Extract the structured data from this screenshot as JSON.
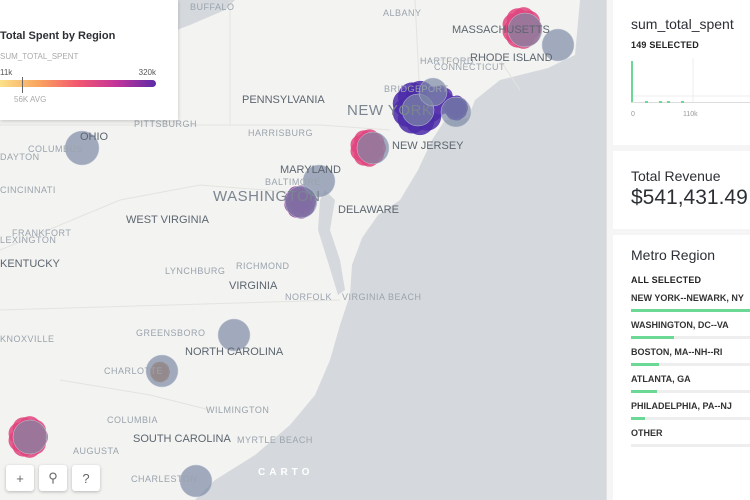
{
  "map": {
    "labels": [
      "BUFFALO",
      "ALBANY",
      "MASSACHUSETTS",
      "RHODE ISLAND",
      "HARTFORD",
      "CONNECTICUT",
      "BRIDGEPORT",
      "PENNSYLVANIA",
      "NEW YORK",
      "NEW JERSEY",
      "PITTSBURGH",
      "HARRISBURG",
      "OHIO",
      "COLUMBUS",
      "DAYTON",
      "MARYLAND",
      "BALTIMORE",
      "WASHINGTON",
      "DELAWARE",
      "CINCINNATI",
      "WEST VIRGINIA",
      "FRANKFORT",
      "LEXINGTON",
      "KENTUCKY",
      "LYNCHBURG",
      "RICHMOND",
      "VIRGINIA",
      "NORFOLK",
      "VIRGINIA BEACH",
      "KNOXVILLE",
      "GREENSBORO",
      "NORTH CAROLINA",
      "CHARLOTTE",
      "COLUMBIA",
      "WILMINGTON",
      "SOUTH CAROLINA",
      "MYRTLE BEACH",
      "AUGUSTA",
      "CHARLESTON"
    ],
    "colors": {
      "land": "#f3f3f1",
      "water": "#d5d9dd",
      "circle": "#7d8aa6"
    },
    "controls": {
      "zoom_in": "+",
      "search": "⚲",
      "help": "?"
    },
    "attribution": "CARTO"
  },
  "legend": {
    "title": "Total Spent by Region",
    "field": "SUM_TOTAL_SPENT",
    "min": "11k",
    "max": "320k",
    "avg": "56K AVG"
  },
  "sidebar": {
    "histogram": {
      "title": "sum_total_spent",
      "status": "149 SELECTED",
      "x_min": "0",
      "x_mid": "110k",
      "accent": "#6bd896"
    },
    "revenue": {
      "title": "Total Revenue",
      "value": "$541,431.49"
    },
    "metro": {
      "title": "Metro Region",
      "status": "ALL SELECTED",
      "items": [
        {
          "label": "NEW YORK--NEWARK, NY",
          "share": 100
        },
        {
          "label": "WASHINGTON, DC--VA",
          "share": 36
        },
        {
          "label": "BOSTON, MA--NH--RI",
          "share": 23
        },
        {
          "label": "ATLANTA, GA",
          "share": 22
        },
        {
          "label": "PHILADELPHIA, PA--NJ",
          "share": 12
        },
        {
          "label": "OTHER",
          "share": 0
        }
      ]
    }
  }
}
